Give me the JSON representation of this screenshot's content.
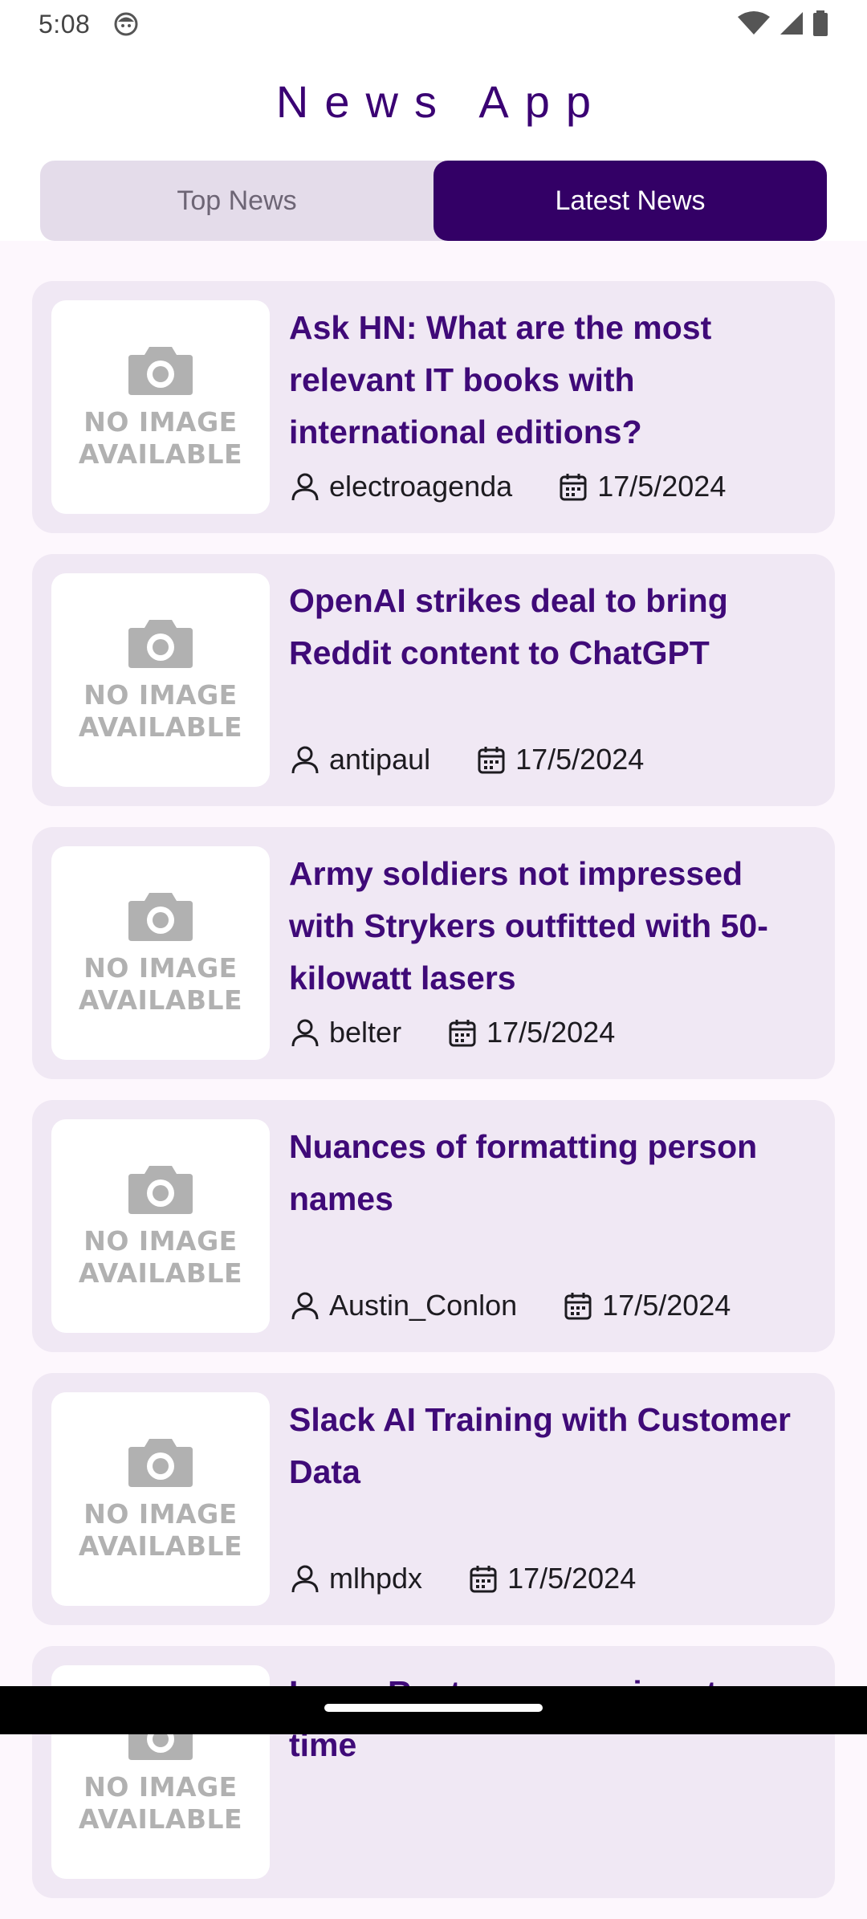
{
  "status_bar": {
    "time": "5:08",
    "icons": [
      "app-notification-icon",
      "wifi-icon",
      "signal-icon",
      "battery-icon"
    ]
  },
  "app": {
    "title": "News App"
  },
  "tabs": [
    {
      "label": "Top News",
      "active": false
    },
    {
      "label": "Latest News",
      "active": true
    }
  ],
  "thumbnail": {
    "line1": "NO IMAGE",
    "line2": "AVAILABLE"
  },
  "articles": [
    {
      "title": "Ask HN: What are the most relevant IT books with international editions?",
      "author": "electroagenda",
      "date": "17/5/2024"
    },
    {
      "title": "OpenAI strikes deal to bring Reddit content to ChatGPT",
      "author": "antipaul",
      "date": "17/5/2024"
    },
    {
      "title": "Army soldiers not impressed with Strykers outfitted with 50-kilowatt lasers",
      "author": "belter",
      "date": "17/5/2024"
    },
    {
      "title": "Nuances of formatting person names",
      "author": "Austin_Conlon",
      "date": "17/5/2024"
    },
    {
      "title": "Slack AI Training with Customer Data",
      "author": "mlhpdx",
      "date": "17/5/2024"
    },
    {
      "title": "Learn Rust, one exercise at a time",
      "author": "",
      "date": ""
    }
  ],
  "colors": {
    "accent": "#330066",
    "title_text": "#3f0a78",
    "card_bg": "#f0e8f4",
    "tab_bg": "#e4dcea"
  }
}
